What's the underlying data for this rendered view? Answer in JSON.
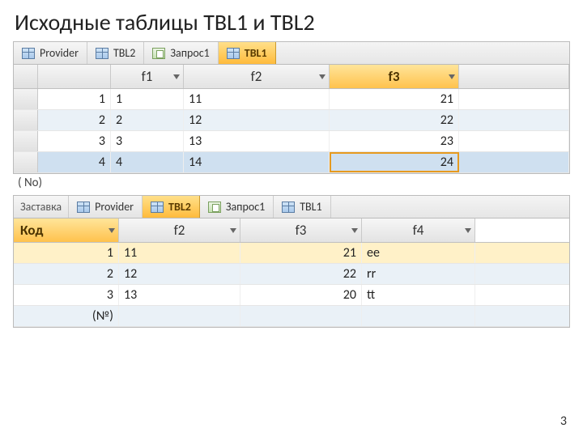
{
  "slide": {
    "title": "Исходные таблицы TBL1 и TBL2",
    "page_number": "3"
  },
  "tbl1": {
    "tabs": [
      {
        "label": "Provider",
        "icon": "table",
        "active": false
      },
      {
        "label": "TBL2",
        "icon": "table",
        "active": false
      },
      {
        "label": "Запрос1",
        "icon": "query",
        "active": false
      },
      {
        "label": "TBL1",
        "icon": "table",
        "active": true
      }
    ],
    "headers": {
      "c1": "f1",
      "c2": "f2",
      "c3": "f3"
    },
    "rows": [
      {
        "a": "1",
        "b": "1",
        "c": "11",
        "d": "21",
        "alt": false,
        "sel": false
      },
      {
        "a": "2",
        "b": "2",
        "c": "12",
        "d": "22",
        "alt": true,
        "sel": false
      },
      {
        "a": "3",
        "b": "3",
        "c": "13",
        "d": "23",
        "alt": false,
        "sel": false
      },
      {
        "a": "4",
        "b": "4",
        "c": "14",
        "d": "24",
        "alt": false,
        "sel": true
      }
    ],
    "new_row_label": "( No)"
  },
  "tbl2": {
    "tabs": [
      {
        "label": "Заставка",
        "icon": "none",
        "active": false
      },
      {
        "label": "Provider",
        "icon": "table",
        "active": false
      },
      {
        "label": "TBL2",
        "icon": "table",
        "active": true
      },
      {
        "label": "Запрос1",
        "icon": "query",
        "active": false
      },
      {
        "label": "TBL1",
        "icon": "table",
        "active": false
      }
    ],
    "headers": {
      "c1": "Код",
      "c2": "f2",
      "c3": "f3",
      "c4": "f4"
    },
    "rows": [
      {
        "a": "1",
        "b": "11",
        "c": "21",
        "d": "ee",
        "alt": false,
        "sel": true
      },
      {
        "a": "2",
        "b": "12",
        "c": "22",
        "d": "rr",
        "alt": true,
        "sel": false
      },
      {
        "a": "3",
        "b": "13",
        "c": "20",
        "d": "tt",
        "alt": false,
        "sel": false
      }
    ],
    "new_row_label": "(№)"
  }
}
